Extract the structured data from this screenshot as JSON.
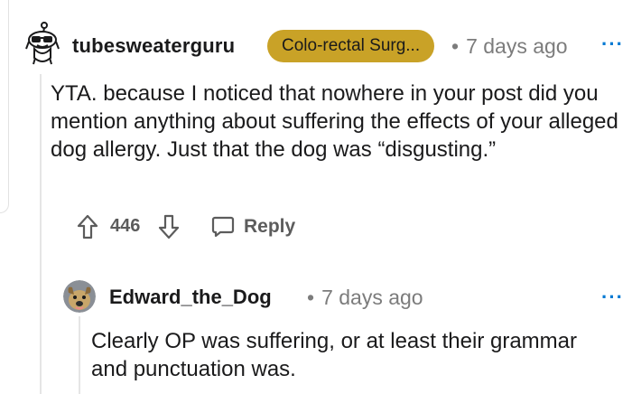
{
  "comment": {
    "username": "tubesweaterguru",
    "flair": "Colo-rectal Surg...",
    "dot": "•",
    "time": "7 days ago",
    "more": "···",
    "body": "YTA. because I noticed that nowhere in your post did you mention anything about suffering the effects of your alleged dog allergy. Just that the dog was “disgusting.”",
    "score": "446",
    "reply_label": "Reply",
    "flair_color": "#c9a227"
  },
  "reply": {
    "username": "Edward_the_Dog",
    "dot": "•",
    "time": "7 days ago",
    "more": "···",
    "body": "Clearly OP was suffering, or at least their grammar and punctuation was."
  },
  "icons": {
    "avatar": "snoo-sunglasses-avatar",
    "upvote": "arrow-up-icon",
    "downvote": "arrow-down-icon",
    "reply": "speech-bubble-icon",
    "reply_avatar": "dog-photo-avatar"
  }
}
